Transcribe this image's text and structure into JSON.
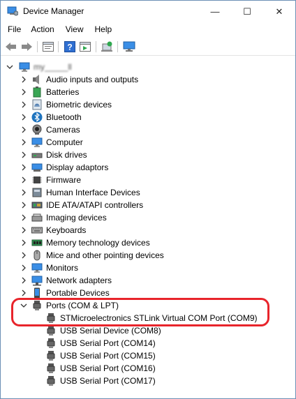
{
  "window": {
    "title": "Device Manager",
    "controls": {
      "minimize": "—",
      "maximize": "☐",
      "close": "✕"
    }
  },
  "menu": {
    "file": "File",
    "action": "Action",
    "view": "View",
    "help": "Help"
  },
  "toolbar": {
    "back": "back-icon",
    "forward": "forward-icon",
    "properties": "properties-icon",
    "help": "help-icon",
    "update": "update-driver-icon",
    "scan": "scan-hardware-icon",
    "display": "monitor-icon"
  },
  "tree": {
    "root": "my_____ll",
    "categories": [
      {
        "label": "Audio inputs and outputs",
        "icon": "speaker-icon"
      },
      {
        "label": "Batteries",
        "icon": "battery-icon"
      },
      {
        "label": "Biometric devices",
        "icon": "fingerprint-icon"
      },
      {
        "label": "Bluetooth",
        "icon": "bluetooth-icon"
      },
      {
        "label": "Cameras",
        "icon": "camera-icon"
      },
      {
        "label": "Computer",
        "icon": "computer-icon"
      },
      {
        "label": "Disk drives",
        "icon": "disk-icon"
      },
      {
        "label": "Display adaptors",
        "icon": "display-adapter-icon"
      },
      {
        "label": "Firmware",
        "icon": "chip-icon"
      },
      {
        "label": "Human Interface Devices",
        "icon": "hid-icon"
      },
      {
        "label": "IDE ATA/ATAPI controllers",
        "icon": "ide-controller-icon"
      },
      {
        "label": "Imaging devices",
        "icon": "scanner-icon"
      },
      {
        "label": "Keyboards",
        "icon": "keyboard-icon"
      },
      {
        "label": "Memory technology devices",
        "icon": "memory-icon"
      },
      {
        "label": "Mice and other pointing devices",
        "icon": "mouse-icon"
      },
      {
        "label": "Monitors",
        "icon": "monitor-icon"
      },
      {
        "label": "Network adapters",
        "icon": "network-icon"
      },
      {
        "label": "Portable Devices",
        "icon": "portable-device-icon"
      }
    ],
    "ports": {
      "label": "Ports (COM & LPT)",
      "children": [
        "STMicroelectronics STLink Virtual COM Port (COM9)",
        "USB Serial Device (COM8)",
        "USB Serial Port (COM14)",
        "USB Serial Port (COM15)",
        "USB Serial Port (COM16)",
        "USB Serial Port (COM17)"
      ]
    }
  },
  "colors": {
    "highlight": "#e8242b",
    "icon_blue": "#1e73be"
  }
}
